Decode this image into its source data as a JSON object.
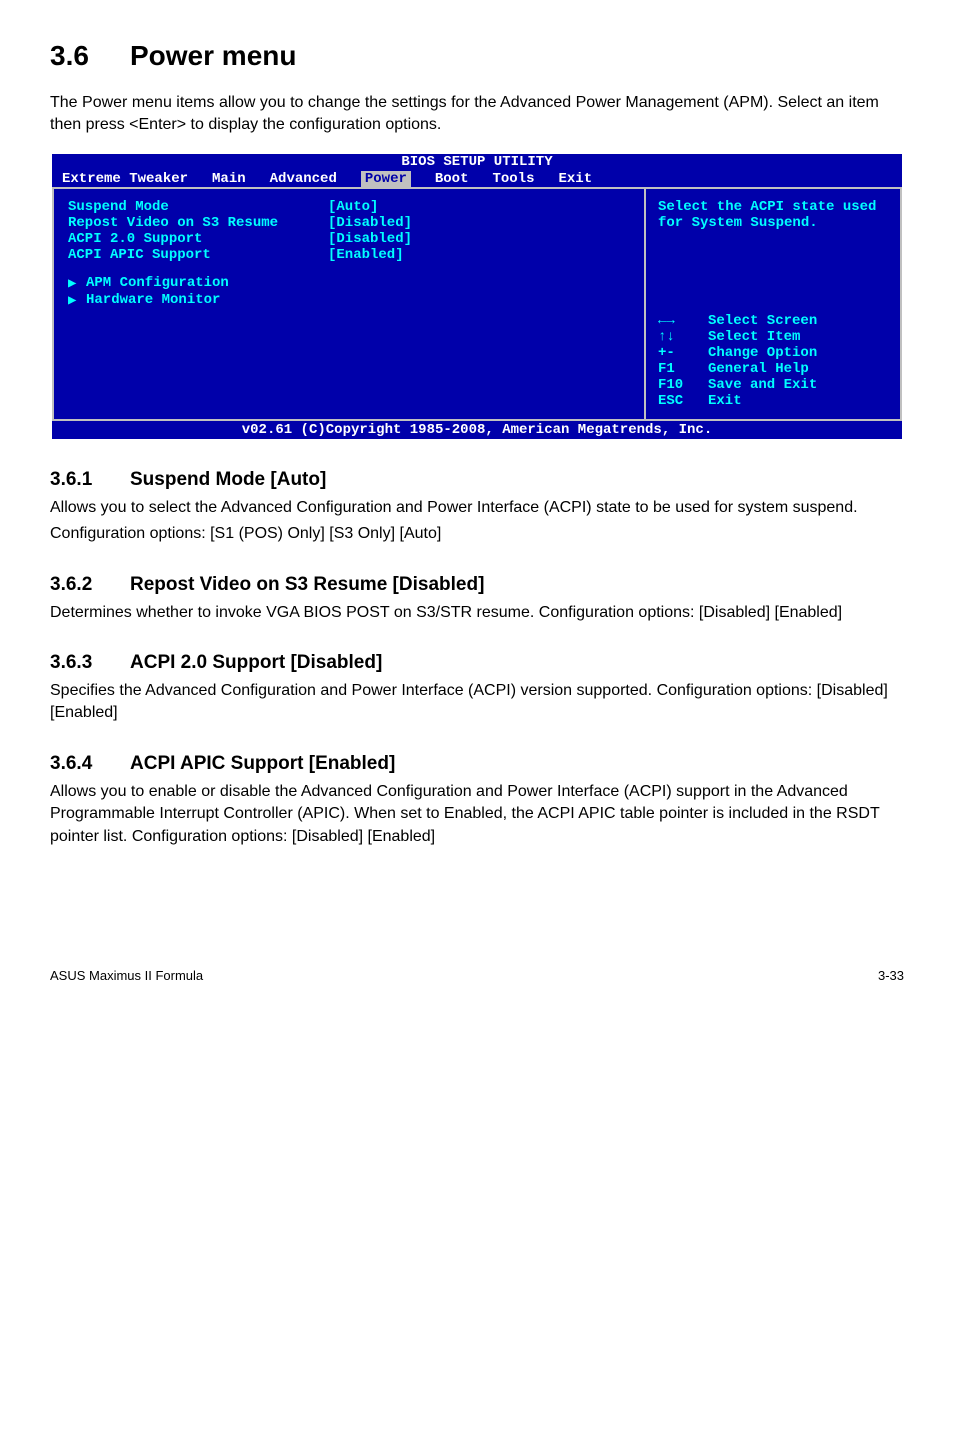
{
  "page": {
    "title_num": "3.6",
    "title_text": "Power menu",
    "intro": "The Power menu items allow you to change the settings for the Advanced Power Management (APM). Select an item then press <Enter> to display the configuration options."
  },
  "bios": {
    "window_title": "BIOS SETUP UTILITY",
    "tabs": [
      "Extreme Tweaker",
      "Main",
      "Advanced",
      "Power",
      "Boot",
      "Tools",
      "Exit"
    ],
    "selected_tab": "Power",
    "left_rows": [
      {
        "label": "Suspend Mode",
        "value": "[Auto]"
      },
      {
        "label": "Repost Video on S3 Resume",
        "value": "[Disabled]"
      },
      {
        "label": "ACPI 2.0 Support",
        "value": "[Disabled]"
      },
      {
        "label": "ACPI APIC Support",
        "value": "[Enabled]"
      }
    ],
    "left_submenus": [
      "APM Configuration",
      "Hardware Monitor"
    ],
    "help_text": "Select the ACPI state used for System Suspend.",
    "keys": [
      {
        "k": "←→",
        "d": "Select Screen"
      },
      {
        "k": "↑↓",
        "d": "Select Item"
      },
      {
        "k": "+-",
        "d": "Change Option"
      },
      {
        "k": "F1",
        "d": "General Help"
      },
      {
        "k": "F10",
        "d": "Save and Exit"
      },
      {
        "k": "ESC",
        "d": "Exit"
      }
    ],
    "footer": "v02.61 (C)Copyright 1985-2008, American Megatrends, Inc."
  },
  "sections": [
    {
      "num": "3.6.1",
      "title": "Suspend Mode [Auto]",
      "paras": [
        "Allows you to select the Advanced Configuration and Power Interface (ACPI) state to be used for system suspend.",
        "Configuration options: [S1 (POS) Only] [S3 Only] [Auto]"
      ]
    },
    {
      "num": "3.6.2",
      "title": "Repost Video on S3 Resume [Disabled]",
      "paras": [
        "Determines whether to invoke VGA BIOS POST on S3/STR resume. Configuration options: [Disabled] [Enabled]"
      ]
    },
    {
      "num": "3.6.3",
      "title": "ACPI 2.0 Support [Disabled]",
      "paras": [
        "Specifies the Advanced Configuration and Power Interface (ACPI) version supported. Configuration options: [Disabled] [Enabled]"
      ]
    },
    {
      "num": "3.6.4",
      "title": "ACPI APIC Support [Enabled]",
      "paras": [
        "Allows you to enable or disable the Advanced Configuration and Power Interface (ACPI) support in the Advanced Programmable Interrupt Controller (APIC). When set to Enabled, the ACPI APIC table pointer is included in the RSDT pointer list. Configuration options: [Disabled] [Enabled]"
      ]
    }
  ],
  "footer": {
    "left": "ASUS Maximus II Formula",
    "right": "3-33"
  }
}
